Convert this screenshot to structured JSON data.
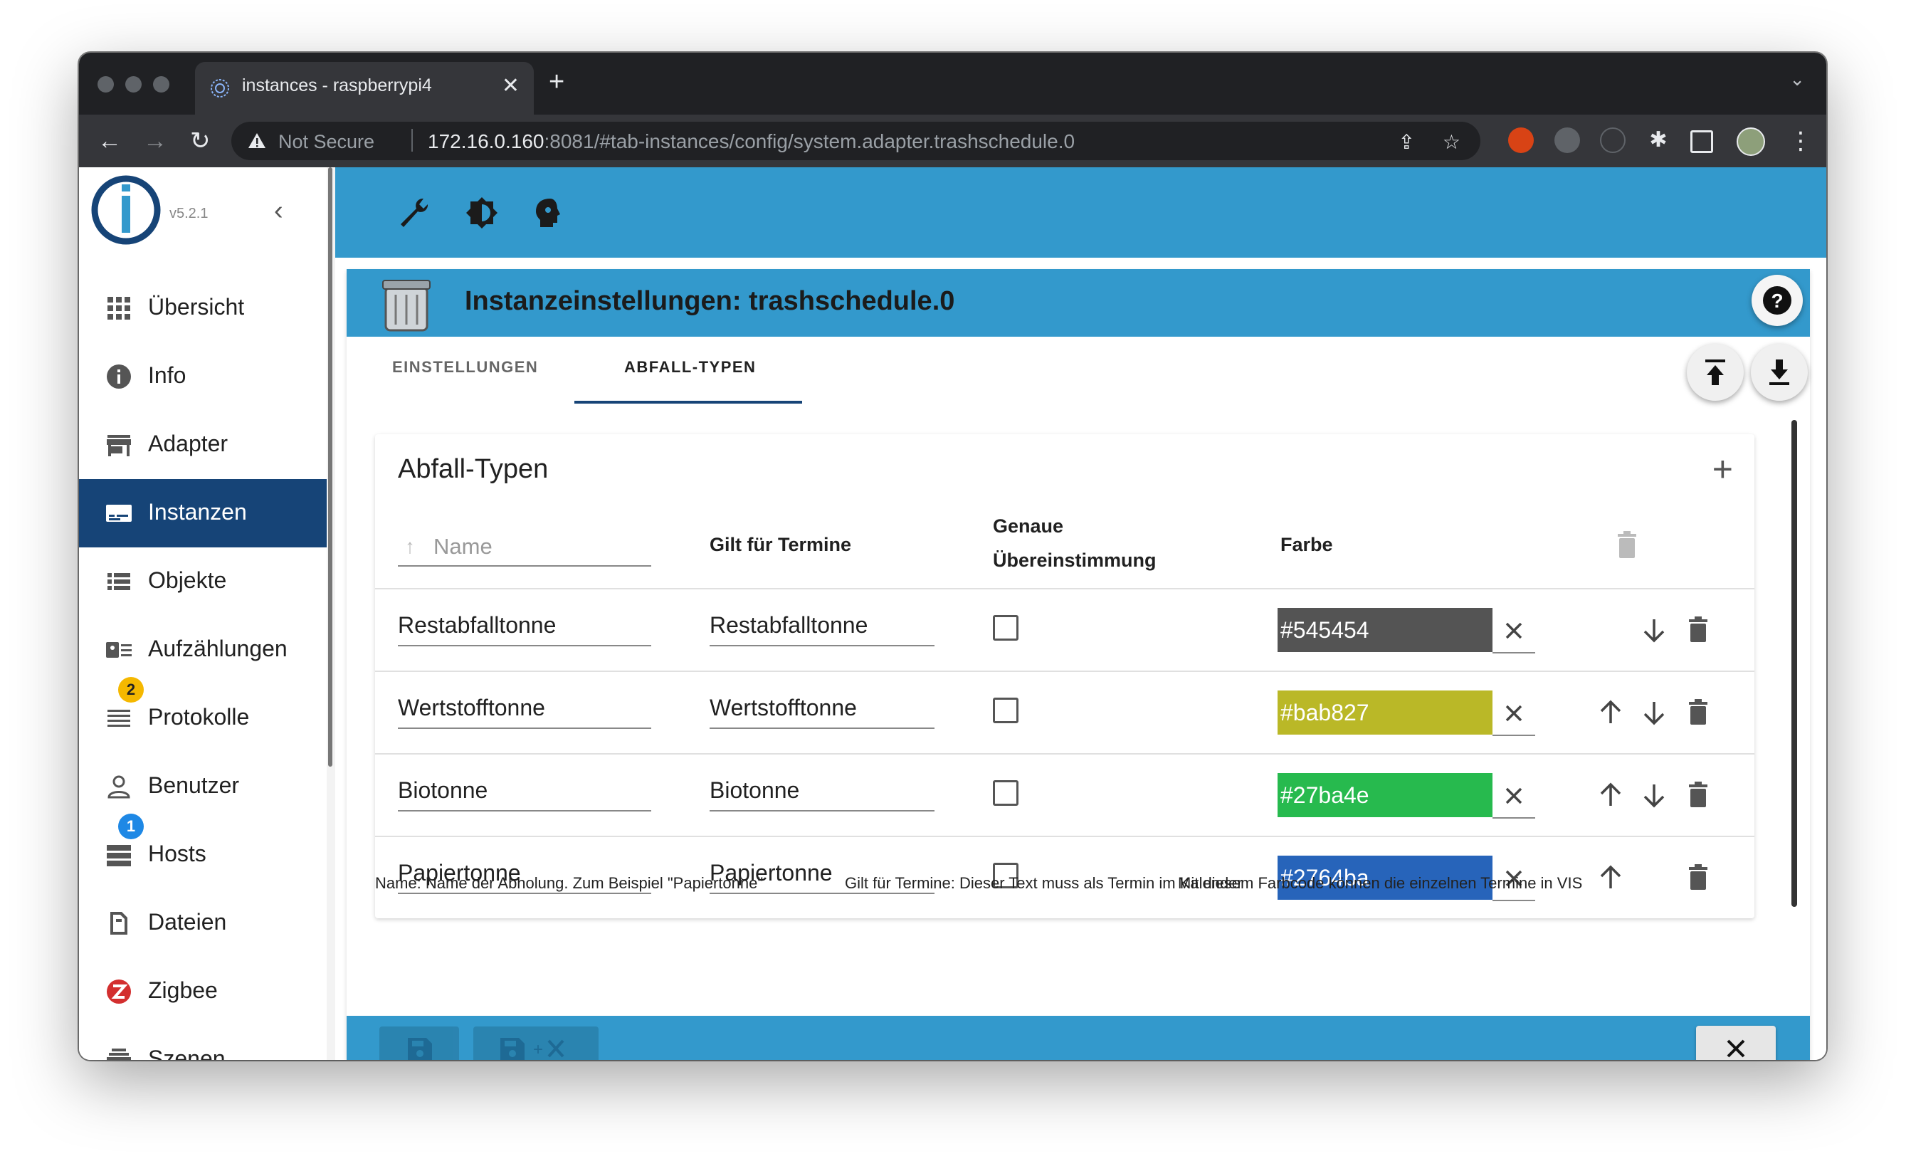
{
  "browser": {
    "tab_title": "instances - raspberrypi4",
    "not_secure": "Not Secure",
    "url_host": "172.16.0.160",
    "url_rest": ":8081/#tab-instances/config/system.adapter.trashschedule.0"
  },
  "sidebar": {
    "version": "v5.2.1",
    "items": [
      {
        "label": "Übersicht",
        "icon": "grid-icon"
      },
      {
        "label": "Info",
        "icon": "info-icon"
      },
      {
        "label": "Adapter",
        "icon": "store-icon"
      },
      {
        "label": "Instanzen",
        "icon": "instances-icon",
        "active": true
      },
      {
        "label": "Objekte",
        "icon": "list-icon"
      },
      {
        "label": "Aufzählungen",
        "icon": "enum-icon"
      },
      {
        "label": "Protokolle",
        "icon": "log-icon",
        "badge": "2"
      },
      {
        "label": "Benutzer",
        "icon": "user-icon"
      },
      {
        "label": "Hosts",
        "icon": "hosts-icon",
        "badge": "1"
      },
      {
        "label": "Dateien",
        "icon": "files-icon"
      },
      {
        "label": "Zigbee",
        "icon": "zigbee-icon"
      },
      {
        "label": "Szenen",
        "icon": "scenes-icon"
      }
    ]
  },
  "panel": {
    "title": "Instanzeinstellungen: trashschedule.0",
    "tabs": [
      "EINSTELLUNGEN",
      "ABFALL-TYPEN"
    ],
    "active_tab": "ABFALL-TYPEN"
  },
  "table": {
    "title": "Abfall-Typen",
    "name_placeholder": "Name",
    "col_termine": "Gilt für Termine",
    "col_match_line1": "Genaue",
    "col_match_line2": "Übereinstimmung",
    "col_color": "Farbe",
    "rows": [
      {
        "name": "Restabfalltonne",
        "match": "Restabfalltonne",
        "exact": false,
        "color": "#545454"
      },
      {
        "name": "Wertstofftonne",
        "match": "Wertstofftonne",
        "exact": false,
        "color": "#bab827"
      },
      {
        "name": "Biotonne",
        "match": "Biotonne",
        "exact": false,
        "color": "#27ba4e"
      },
      {
        "name": "Papiertonne",
        "match": "Papiertonne",
        "exact": false,
        "color": "#2764ba"
      }
    ]
  },
  "footnotes": [
    "Name: Name der Abholung. Zum Beispiel \"Papiertonne\"",
    "Gilt für Termine: Dieser Text muss als Termin im Kalender",
    "Mit diesem Farbcode können die einzelnen Termine in VIS"
  ],
  "colors": {
    "primary": "#3399cc",
    "sidebar_active": "#164477",
    "badge_warning": "#f5b800",
    "badge_info": "#1e88e5"
  }
}
